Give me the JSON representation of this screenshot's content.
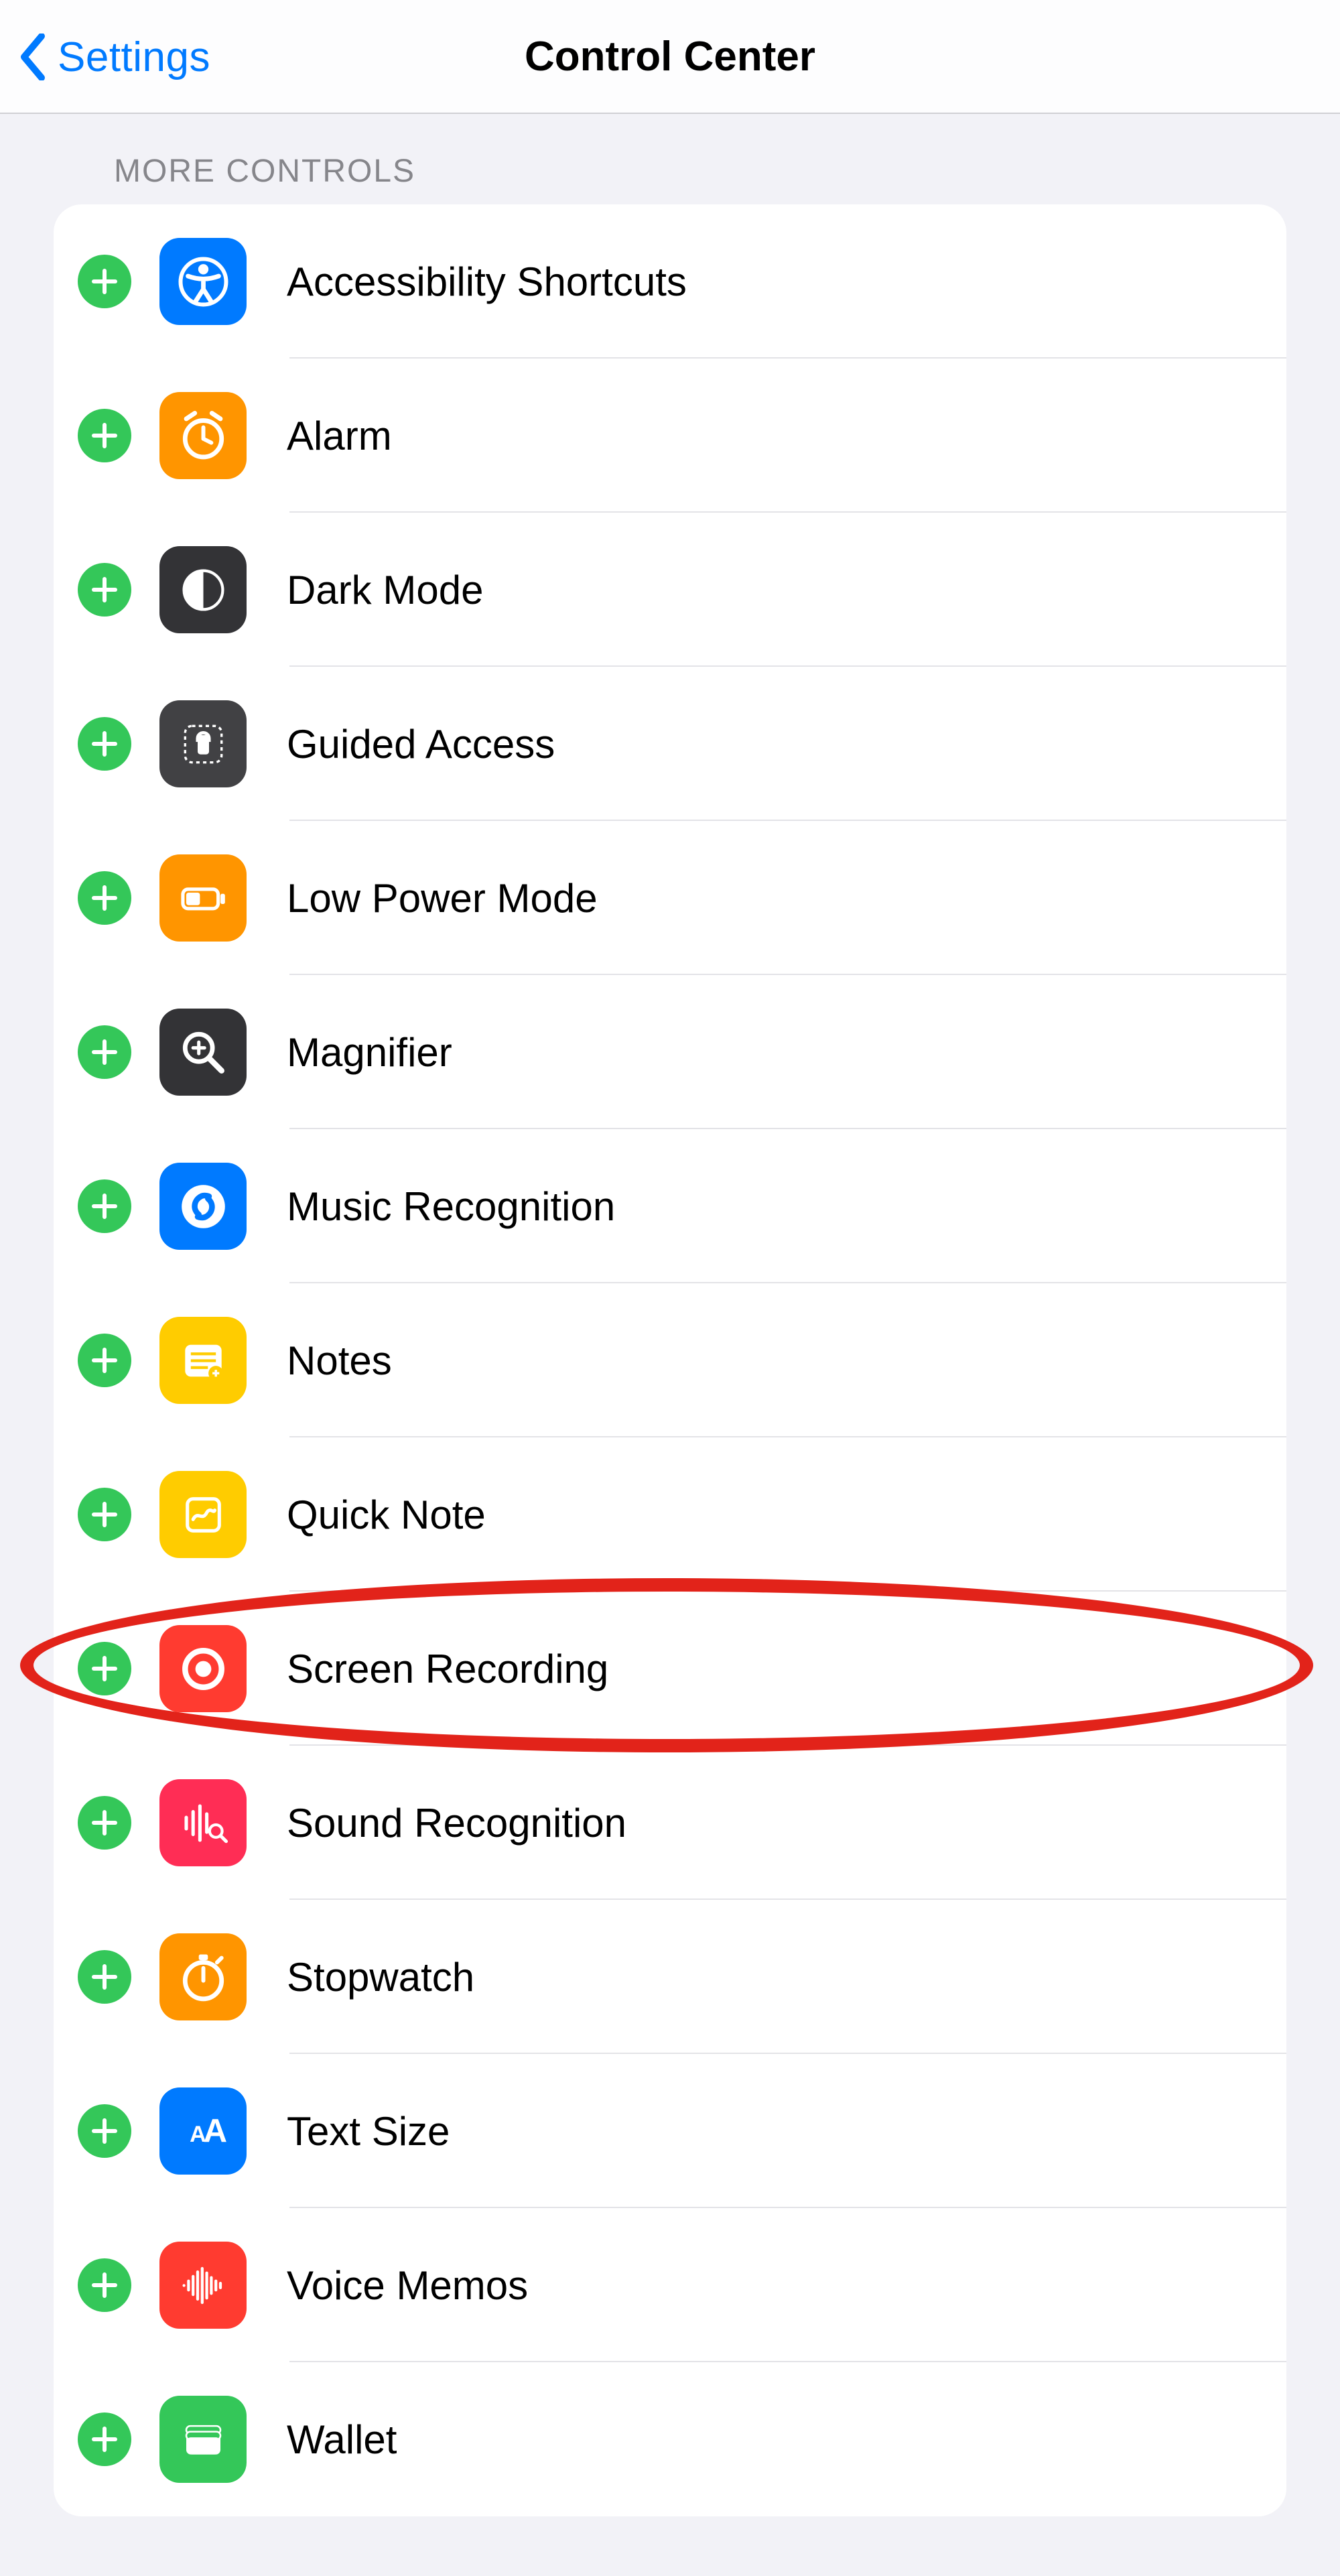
{
  "nav": {
    "back_label": "Settings",
    "title": "Control Center"
  },
  "section": {
    "header": "MORE CONTROLS"
  },
  "controls": [
    {
      "label": "Accessibility Shortcuts",
      "icon": "accessibility",
      "bg": "bg-blue",
      "name": "row-accessibility-shortcuts"
    },
    {
      "label": "Alarm",
      "icon": "alarm",
      "bg": "bg-orange",
      "name": "row-alarm"
    },
    {
      "label": "Dark Mode",
      "icon": "darkmode",
      "bg": "bg-dark",
      "name": "row-dark-mode"
    },
    {
      "label": "Guided Access",
      "icon": "guided",
      "bg": "bg-dark2",
      "name": "row-guided-access"
    },
    {
      "label": "Low Power Mode",
      "icon": "battery",
      "bg": "bg-orange",
      "name": "row-low-power-mode"
    },
    {
      "label": "Magnifier",
      "icon": "magnifier",
      "bg": "bg-dark",
      "name": "row-magnifier"
    },
    {
      "label": "Music Recognition",
      "icon": "shazam",
      "bg": "bg-blue",
      "name": "row-music-recognition"
    },
    {
      "label": "Notes",
      "icon": "notes",
      "bg": "bg-yellow",
      "name": "row-notes"
    },
    {
      "label": "Quick Note",
      "icon": "quicknote",
      "bg": "bg-yellow",
      "name": "row-quick-note"
    },
    {
      "label": "Screen Recording",
      "icon": "record",
      "bg": "bg-red",
      "name": "row-screen-recording",
      "highlighted": true
    },
    {
      "label": "Sound Recognition",
      "icon": "soundrec",
      "bg": "bg-pink",
      "name": "row-sound-recognition"
    },
    {
      "label": "Stopwatch",
      "icon": "stopwatch",
      "bg": "bg-orange",
      "name": "row-stopwatch"
    },
    {
      "label": "Text Size",
      "icon": "textsize",
      "bg": "bg-blue",
      "name": "row-text-size"
    },
    {
      "label": "Voice Memos",
      "icon": "voicememo",
      "bg": "bg-red",
      "name": "row-voice-memos"
    },
    {
      "label": "Wallet",
      "icon": "wallet",
      "bg": "bg-green",
      "name": "row-wallet"
    }
  ],
  "colors": {
    "accent": "#007aff",
    "add_button": "#34c759",
    "highlight": "#e2231a"
  }
}
